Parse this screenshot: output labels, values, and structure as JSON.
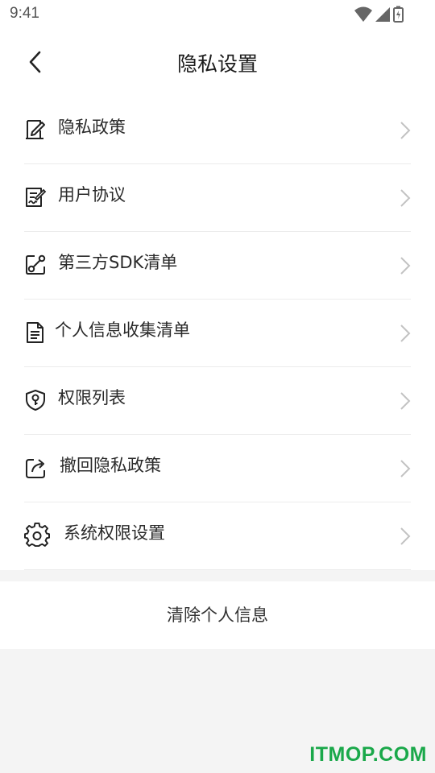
{
  "status_bar": {
    "time": "9:41"
  },
  "header": {
    "title": "隐私设置"
  },
  "menu": {
    "items": [
      {
        "label": "隐私政策",
        "icon": "document-edit-icon"
      },
      {
        "label": "用户协议",
        "icon": "signed-agreement-icon"
      },
      {
        "label": "第三方SDK清单",
        "icon": "link-share-icon"
      },
      {
        "label": "个人信息收集清单",
        "icon": "file-list-icon"
      },
      {
        "label": "权限列表",
        "icon": "shield-key-icon"
      },
      {
        "label": "撤回隐私政策",
        "icon": "revoke-share-icon"
      },
      {
        "label": "系统权限设置",
        "icon": "gear-icon"
      }
    ]
  },
  "actions": {
    "clear_label": "清除个人信息"
  },
  "watermark": "ITMOP.COM",
  "colors": {
    "page_background": "#f4f4f4",
    "card_background": "#ffffff",
    "divider": "#ececec",
    "watermark": "#1aa84a"
  }
}
